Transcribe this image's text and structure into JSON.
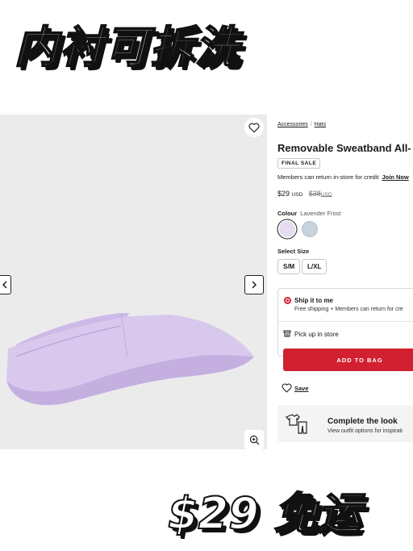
{
  "overlay": {
    "headline": "内衬可拆洗",
    "promo": "$29 免运"
  },
  "gallery": {
    "icons": [
      "heart-icon",
      "chevron-left-icon",
      "chevron-right-icon",
      "zoom-in-icon"
    ]
  },
  "product": {
    "breadcrumb": [
      "Accessories",
      "/",
      "Hats"
    ],
    "title": "Removable Sweatband All-",
    "badge": "FINAL SALE",
    "returns_text": "Members can return in-store for credit",
    "join_label": "Join Now",
    "price": "$29",
    "price_currency": "USD",
    "was_price": "$38",
    "was_currency": "USD",
    "colour_label": "Colour",
    "colour_value": "Lavender Frost",
    "swatches": [
      {
        "name": "Lavender Frost",
        "color": "#e6dcf0",
        "selected": true
      },
      {
        "name": "Light Blue Grey",
        "color": "#c7d2dc",
        "selected": false
      }
    ],
    "size_label": "Select Size",
    "sizes": [
      "S/M",
      "L/XL"
    ],
    "ship_title": "Ship it to me",
    "ship_sub": "Free shipping + Members can return for cre",
    "pickup_label": "Pick up in store",
    "add_to_bag": "ADD TO BAG",
    "save_label": "Save",
    "look_title": "Complete the look",
    "look_sub": "View outfit options for inspirati"
  },
  "colors": {
    "accent": "#d1202f",
    "hat": "#d9c8ee"
  }
}
